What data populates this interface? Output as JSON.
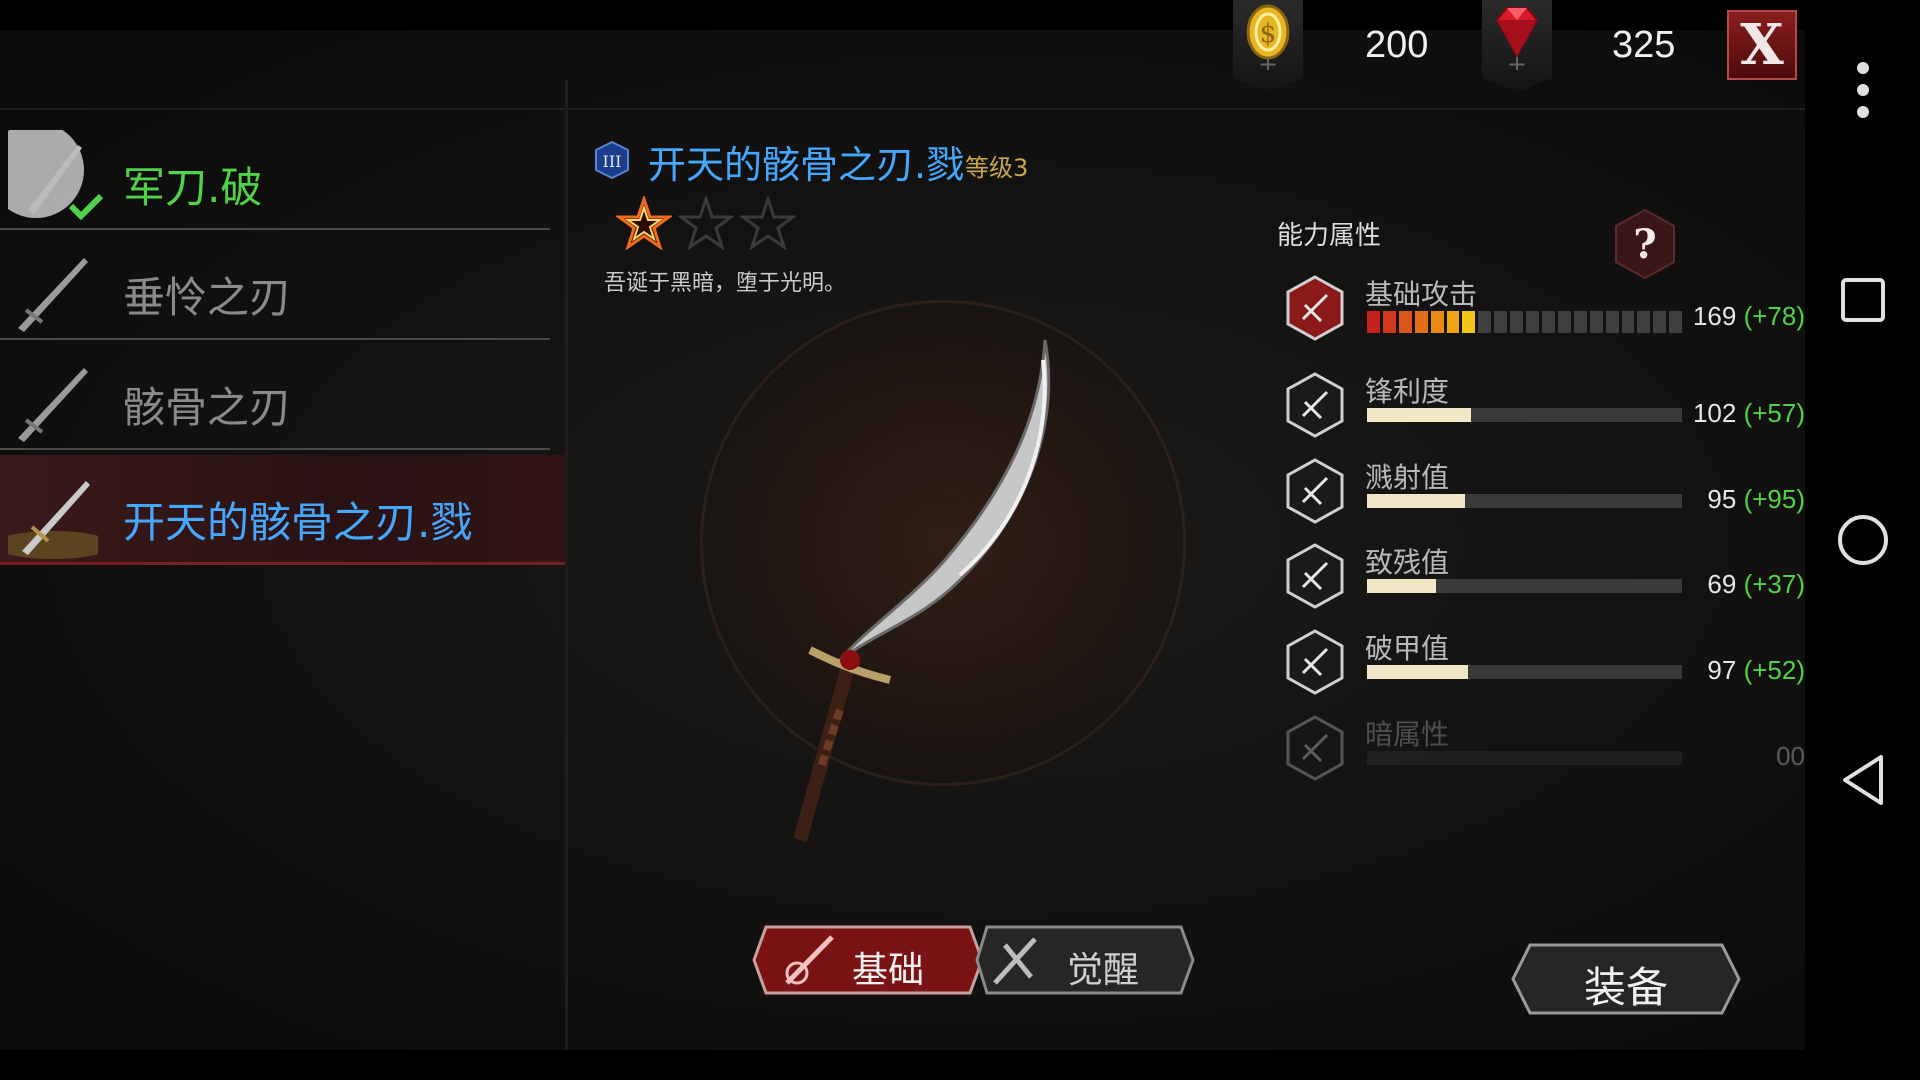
{
  "currency": {
    "gold": {
      "icon": "gold-coin-icon",
      "value": "200"
    },
    "gem": {
      "icon": "red-gem-icon",
      "value": "325"
    },
    "close_label": "X"
  },
  "weapon_list": [
    {
      "name": "军刀.破",
      "color": "#52d24a",
      "equipped": true,
      "selected": false
    },
    {
      "name": "垂怜之刃",
      "color": "#8a8a8a",
      "equipped": false,
      "selected": false
    },
    {
      "name": "骸骨之刃",
      "color": "#8a8a8a",
      "equipped": false,
      "selected": false
    },
    {
      "name": "开天的骸骨之刃.戮",
      "color": "#45a8ff",
      "equipped": false,
      "selected": true
    }
  ],
  "detail": {
    "title": "开天的骸骨之刃.戮",
    "level": "等级3",
    "stars_total": 3,
    "stars_filled": 1,
    "flavor": "吾诞于黑暗，堕于光明。"
  },
  "tabs": {
    "basic": "基础",
    "awaken": "觉醒",
    "active": "basic"
  },
  "stats": {
    "title": "能力属性",
    "items": [
      {
        "label": "基础攻击",
        "value": "169",
        "bonus": "(+78)",
        "fraction": 0.35,
        "segmented": true,
        "segments": 20,
        "filled_segments": 7,
        "icon": "attack-icon"
      },
      {
        "label": "锋利度",
        "value": "102",
        "bonus": "(+57)",
        "fraction": 0.33,
        "segmented": false,
        "icon": "sharpness-icon"
      },
      {
        "label": "溅射值",
        "value": "95",
        "bonus": "(+95)",
        "fraction": 0.31,
        "segmented": false,
        "icon": "splash-icon"
      },
      {
        "label": "致残值",
        "value": "69",
        "bonus": "(+37)",
        "fraction": 0.22,
        "segmented": false,
        "icon": "cripple-icon"
      },
      {
        "label": "破甲值",
        "value": "97",
        "bonus": "(+52)",
        "fraction": 0.32,
        "segmented": false,
        "icon": "armor-break-icon"
      },
      {
        "label": "暗属性",
        "value": "00",
        "bonus": "",
        "fraction": 0,
        "segmented": false,
        "dim": true,
        "icon": "dark-element-icon"
      }
    ]
  },
  "equip_label": "装备",
  "colors": {
    "accent_red": "#8a1e1e",
    "bonus_green": "#52d24a",
    "title_blue": "#45a8ff",
    "level_gold": "#c8a64c"
  }
}
